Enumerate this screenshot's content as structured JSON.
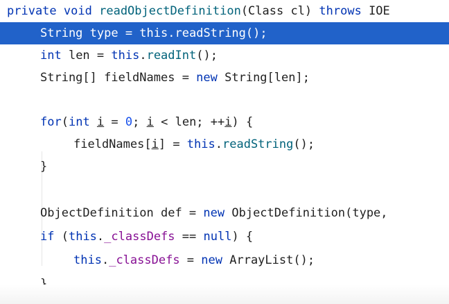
{
  "code": {
    "l1": {
      "a": "private",
      "b": " ",
      "c": "void",
      "d": " ",
      "e": "readObjectDefinition",
      "f": "(Class cl) ",
      "g": "throws",
      "h": " IOE"
    },
    "l2": {
      "a": "String type = ",
      "b": "this",
      "c": ".",
      "d": "readString",
      "e": "();"
    },
    "l3": {
      "a": "int",
      "b": " len = ",
      "c": "this",
      "d": ".",
      "e": "readInt",
      "f": "();"
    },
    "l4": {
      "a": "String[] fieldNames = ",
      "b": "new",
      "c": " String[len];"
    },
    "l5": {
      "a": "for",
      "b": "(",
      "c": "int",
      "d": " ",
      "e": "i",
      "f": " = ",
      "g": "0",
      "h": "; ",
      "i": "i",
      "j": " < len; ++",
      "k": "i",
      "l": ") {"
    },
    "l6": {
      "a": "fieldNames[",
      "b": "i",
      "c": "] = ",
      "d": "this",
      "e": ".",
      "f": "readString",
      "g": "();"
    },
    "l7": {
      "a": "}"
    },
    "l8": {
      "a": "ObjectDefinition def = ",
      "b": "new",
      "c": " ObjectDefinition(type, "
    },
    "l9": {
      "a": "if",
      "b": " (",
      "c": "this",
      "d": ".",
      "e": "_classDefs",
      "f": " == ",
      "g": "null",
      "h": ") {"
    },
    "l10": {
      "a": "this",
      "b": ".",
      "c": "_classDefs",
      "d": " = ",
      "e": "new",
      "f": " ArrayList();"
    },
    "l11": {
      "a": "}"
    }
  },
  "colors": {
    "keyword": "#0033b3",
    "method": "#00627a",
    "field": "#871094",
    "number": "#1750eb",
    "selection": "#2162c9"
  }
}
